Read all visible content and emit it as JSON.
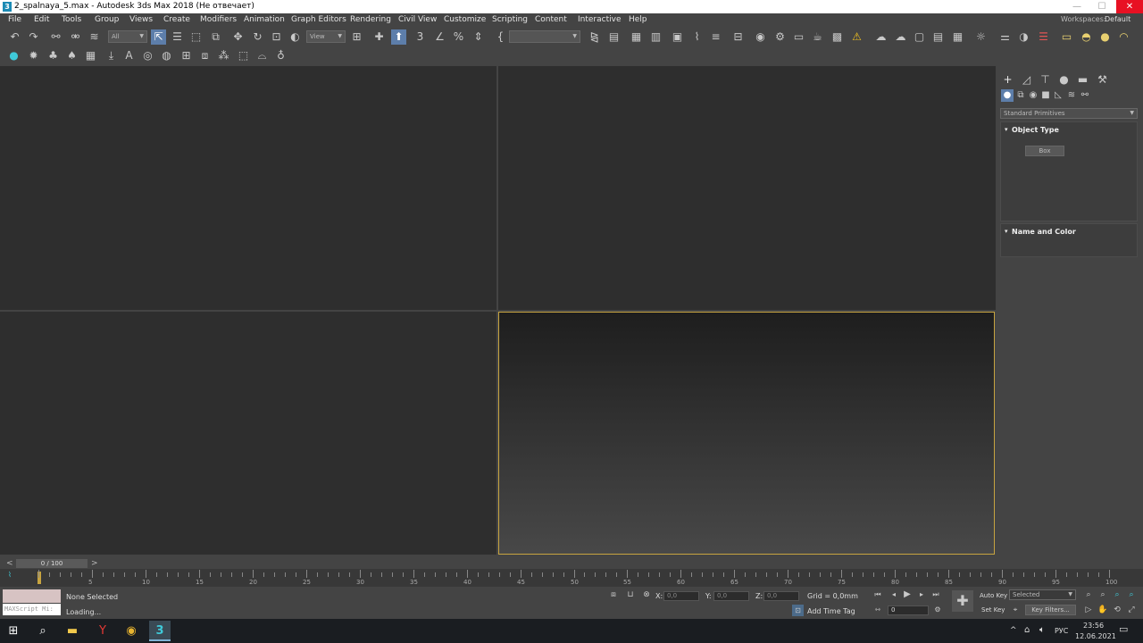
{
  "window": {
    "app_icon": "3",
    "title": "2_spalnaya_5.max - Autodesk 3ds Max 2018  (Не отвечает)",
    "minimize": "—",
    "maximize": "☐",
    "close": "✕"
  },
  "menu": {
    "items": [
      "File",
      "Edit",
      "Tools",
      "Group",
      "Views",
      "Create",
      "Modifiers",
      "Animation",
      "Graph Editors",
      "Rendering",
      "Civil View",
      "Customize",
      "Scripting",
      "Content",
      "Interactive",
      "Help"
    ],
    "workspaces_label": "Workspaces:",
    "workspaces_value": "Default"
  },
  "toolbar": {
    "selection_filter": "All",
    "ref_coord": "View",
    "named_selection": "",
    "snap_3": "3"
  },
  "command_panel": {
    "category": "Standard Primitives",
    "object_type_title": "Object Type",
    "box_button": "Box",
    "name_color_title": "Name and Color"
  },
  "timeline": {
    "frame_counter": "0 / 100",
    "prev": "<",
    "next": ">",
    "ticks": [
      "5",
      "10",
      "15",
      "20",
      "25",
      "30",
      "35",
      "40",
      "45",
      "50",
      "55",
      "60",
      "65",
      "70",
      "75",
      "80",
      "85",
      "90",
      "95",
      "100"
    ]
  },
  "status": {
    "maxscript_placeholder": "MAXScript Mi:",
    "selection": "None Selected",
    "prompt": "Loading...",
    "x_label": "X:",
    "y_label": "Y:",
    "z_label": "Z:",
    "x_value": "0,0",
    "y_value": "0,0",
    "z_value": "0,0",
    "grid": "Grid = 0,0mm",
    "add_time_tag": "Add Time Tag",
    "auto_key": "Auto Key",
    "set_key": "Set Key",
    "key_mode": "Selected",
    "key_filters": "Key Filters...",
    "frame_field": "0"
  },
  "taskbar": {
    "lang": "РУС",
    "time": "23:56",
    "date": "12.06.2021",
    "active_app": "3"
  },
  "colors": {
    "accent_cyan": "#3fc9d8",
    "viewport_border": "#c7a440",
    "close_red": "#e81123"
  }
}
